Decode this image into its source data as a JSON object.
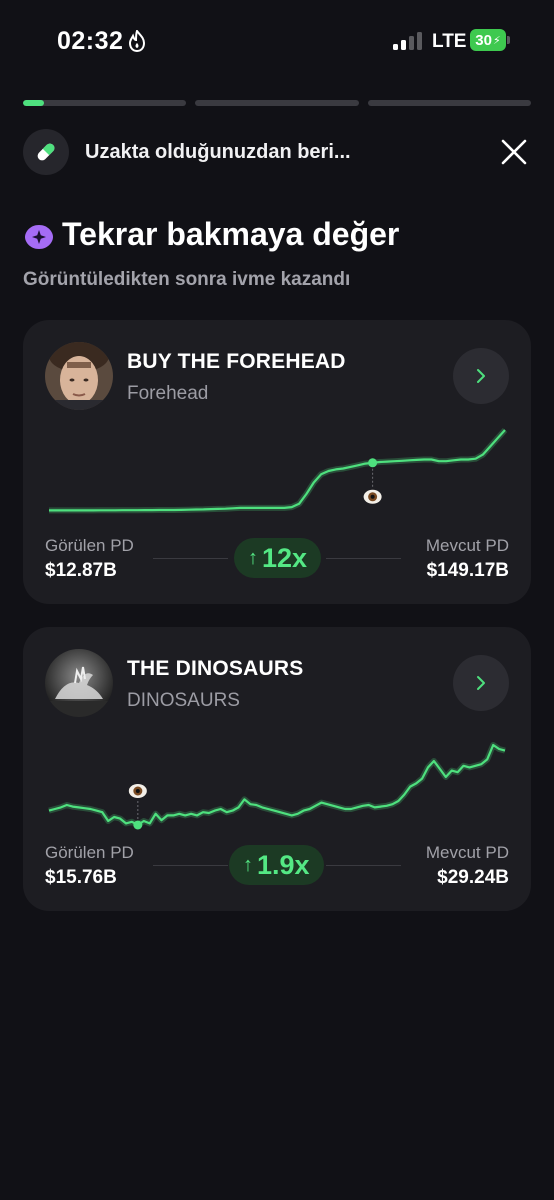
{
  "status_bar": {
    "time": "02:32",
    "network": "LTE",
    "battery": "30"
  },
  "progress": {
    "segments": 3,
    "active_fraction": 0.13
  },
  "header": {
    "title": "Uzakta olduğunuzdan beri...",
    "icon": "pill-icon",
    "close_icon": "close-icon"
  },
  "section": {
    "icon": "eye-icon",
    "title": "Tekrar bakmaya değer",
    "subtitle": "Görüntüledikten sonra ivme kazandı"
  },
  "colors": {
    "accent_green": "#4ee07e",
    "badge_bg": "#1c3a24",
    "card_bg": "#1d1d22",
    "section_icon": "#a56cf5"
  },
  "cards": [
    {
      "name": "BUY THE FOREHEAD",
      "symbol": "Forehead",
      "seen_label": "Görülen PD",
      "seen_value": "$12.87B",
      "current_label": "Mevcut PD",
      "current_value": "$149.17B",
      "multiplier": "12x",
      "chart_data": {
        "type": "line",
        "values": [
          0.02,
          0.02,
          0.02,
          0.02,
          0.02,
          0.02,
          0.02,
          0.021,
          0.021,
          0.021,
          0.022,
          0.022,
          0.022,
          0.023,
          0.023,
          0.024,
          0.024,
          0.025,
          0.026,
          0.028,
          0.03,
          0.032,
          0.035,
          0.038,
          0.04,
          0.045,
          0.05,
          0.05,
          0.05,
          0.05,
          0.05,
          0.05,
          0.05,
          0.06,
          0.1,
          0.22,
          0.36,
          0.46,
          0.5,
          0.52,
          0.53,
          0.55,
          0.57,
          0.59,
          0.6,
          0.61,
          0.615,
          0.62,
          0.625,
          0.63,
          0.635,
          0.64,
          0.64,
          0.62,
          0.62,
          0.63,
          0.64,
          0.64,
          0.65,
          0.7,
          0.8,
          0.9,
          1.0
        ],
        "seen_index": 44
      }
    },
    {
      "name": "THE DINOSAURS",
      "symbol": "DINOSAURS",
      "seen_label": "Görülen PD",
      "seen_value": "$15.76B",
      "current_label": "Mevcut PD",
      "current_value": "$29.24B",
      "multiplier": "1.9x",
      "chart_data": {
        "type": "line",
        "values": [
          0.18,
          0.2,
          0.22,
          0.25,
          0.23,
          0.22,
          0.21,
          0.2,
          0.18,
          0.16,
          0.05,
          0.1,
          0.08,
          0.02,
          0.04,
          0.0,
          0.05,
          0.02,
          0.14,
          0.06,
          0.12,
          0.12,
          0.14,
          0.12,
          0.14,
          0.12,
          0.16,
          0.15,
          0.18,
          0.2,
          0.16,
          0.18,
          0.22,
          0.32,
          0.26,
          0.25,
          0.22,
          0.2,
          0.18,
          0.16,
          0.14,
          0.12,
          0.14,
          0.18,
          0.2,
          0.24,
          0.28,
          0.26,
          0.24,
          0.22,
          0.2,
          0.2,
          0.22,
          0.24,
          0.25,
          0.22,
          0.23,
          0.24,
          0.26,
          0.3,
          0.38,
          0.48,
          0.52,
          0.58,
          0.72,
          0.8,
          0.7,
          0.6,
          0.68,
          0.66,
          0.74,
          0.72,
          0.74,
          0.76,
          0.82,
          1.0,
          0.95,
          0.93
        ],
        "seen_index": 15
      }
    }
  ]
}
